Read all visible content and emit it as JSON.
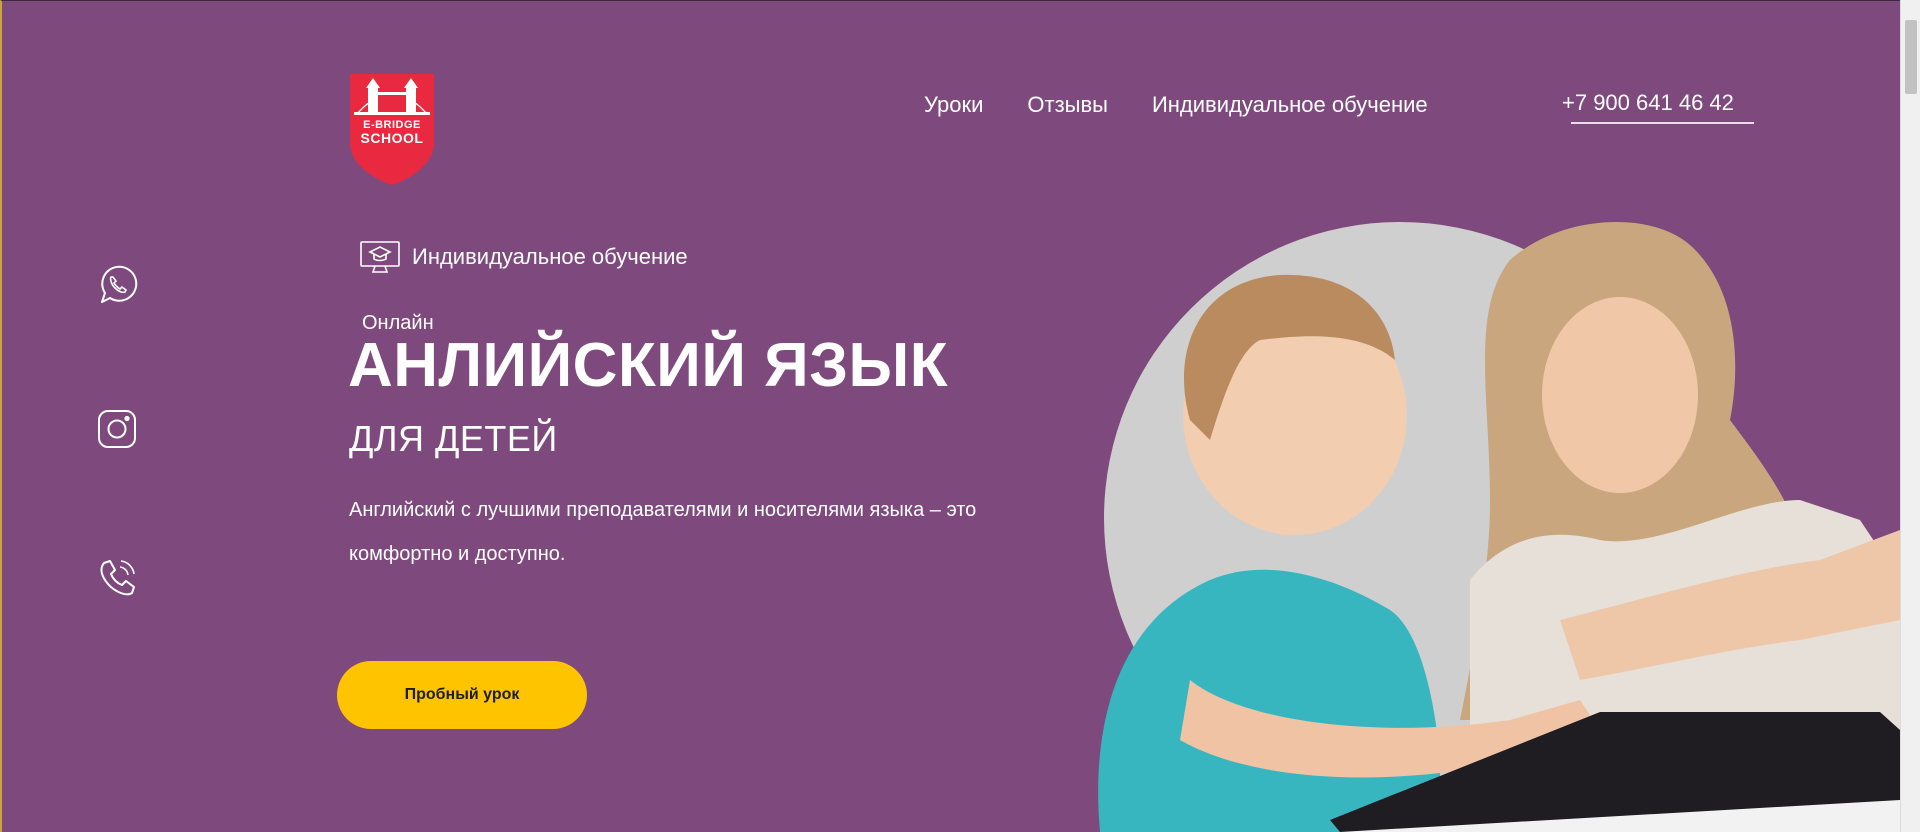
{
  "logo": {
    "line1": "E-BRIDGE",
    "line2": "SCHOOL"
  },
  "nav": {
    "items": [
      {
        "label": "Уроки"
      },
      {
        "label": "Отзывы"
      },
      {
        "label": "Индивидуальное обучение"
      }
    ],
    "phone": "+7 900 641 46 42"
  },
  "social": [
    {
      "icon": "whatsapp-icon"
    },
    {
      "icon": "instagram-icon"
    },
    {
      "icon": "phone-icon"
    }
  ],
  "hero": {
    "badge": "Индивидуальное обучение",
    "online": "Онлайн",
    "headline": "АНЛИЙСКИЙ ЯЗЫК",
    "subhead": "ДЛЯ ДЕТЕЙ",
    "description": "Английский с лучшими преподавателями и носителями языка – это комфортно и доступно.",
    "cta": "Пробный урок"
  },
  "colors": {
    "background": "#7e4a7d",
    "accent": "#ffc400",
    "logo_red": "#e8293f",
    "circle": "#cfcfcf"
  }
}
